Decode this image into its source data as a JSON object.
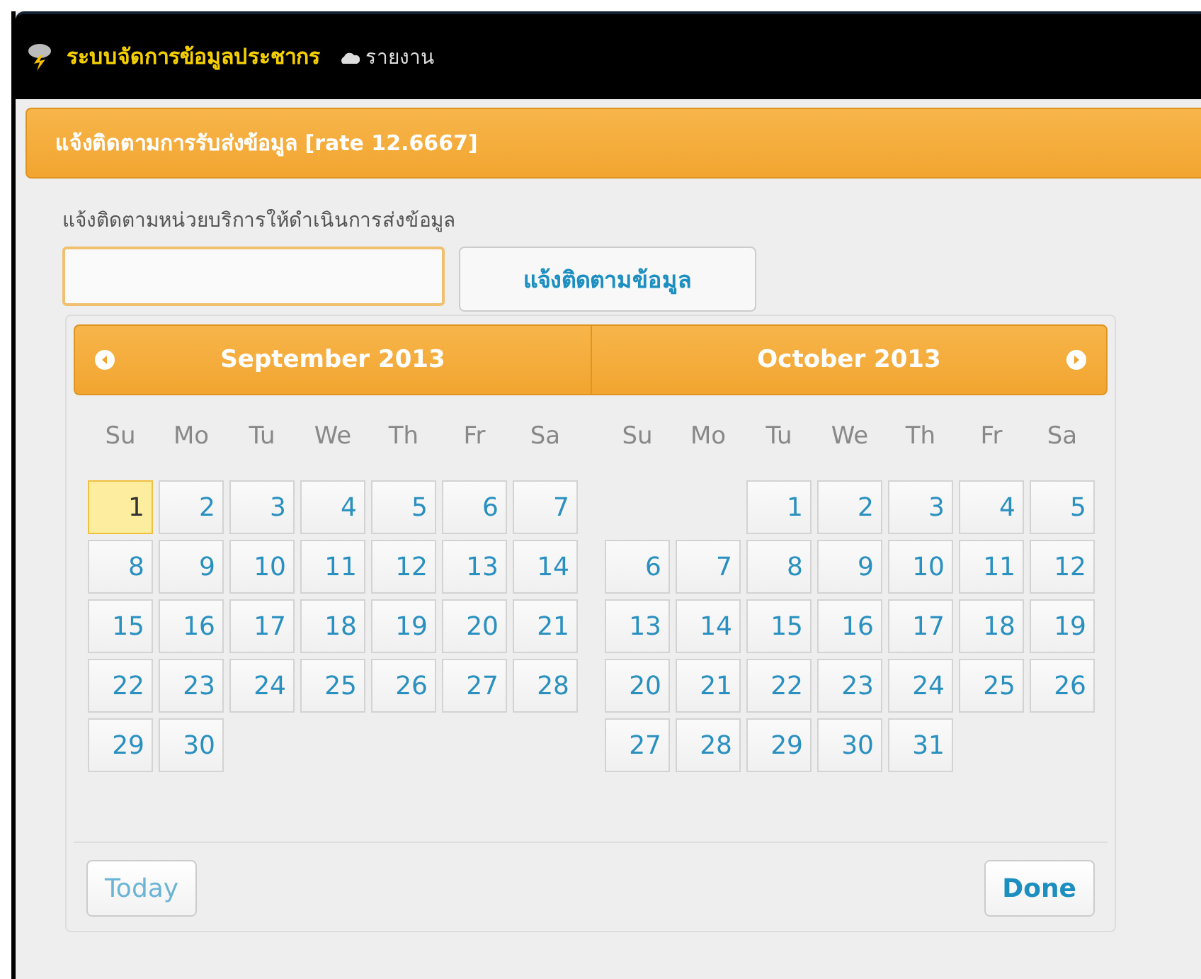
{
  "navbar": {
    "brand": "ระบบจัดการข้อมูลประชากร",
    "link": "รายงาน"
  },
  "panel": {
    "title": "แจ้งติดตามการรับส่งข้อมูล [rate 12.6667]"
  },
  "form": {
    "label": "แจ้งติดตามหน่วยบริการให้ดำเนินการส่งข้อมูล",
    "button": "แจ้งติดตามข้อมูล"
  },
  "datepicker": {
    "months": [
      {
        "title": "September 2013",
        "weekdays": [
          "Su",
          "Mo",
          "Tu",
          "We",
          "Th",
          "Fr",
          "Sa"
        ],
        "weeks": [
          [
            {
              "kind": "day",
              "d": "1",
              "today": true
            },
            {
              "kind": "day",
              "d": "2",
              "today": false
            },
            {
              "kind": "day",
              "d": "3",
              "today": false
            },
            {
              "kind": "day",
              "d": "4",
              "today": false
            },
            {
              "kind": "day",
              "d": "5",
              "today": false
            },
            {
              "kind": "day",
              "d": "6",
              "today": false
            },
            {
              "kind": "day",
              "d": "7",
              "today": false
            }
          ],
          [
            {
              "kind": "day",
              "d": "8",
              "today": false
            },
            {
              "kind": "day",
              "d": "9",
              "today": false
            },
            {
              "kind": "day",
              "d": "10",
              "today": false
            },
            {
              "kind": "day",
              "d": "11",
              "today": false
            },
            {
              "kind": "day",
              "d": "12",
              "today": false
            },
            {
              "kind": "day",
              "d": "13",
              "today": false
            },
            {
              "kind": "day",
              "d": "14",
              "today": false
            }
          ],
          [
            {
              "kind": "day",
              "d": "15",
              "today": false
            },
            {
              "kind": "day",
              "d": "16",
              "today": false
            },
            {
              "kind": "day",
              "d": "17",
              "today": false
            },
            {
              "kind": "day",
              "d": "18",
              "today": false
            },
            {
              "kind": "day",
              "d": "19",
              "today": false
            },
            {
              "kind": "day",
              "d": "20",
              "today": false
            },
            {
              "kind": "day",
              "d": "21",
              "today": false
            }
          ],
          [
            {
              "kind": "day",
              "d": "22",
              "today": false
            },
            {
              "kind": "day",
              "d": "23",
              "today": false
            },
            {
              "kind": "day",
              "d": "24",
              "today": false
            },
            {
              "kind": "day",
              "d": "25",
              "today": false
            },
            {
              "kind": "day",
              "d": "26",
              "today": false
            },
            {
              "kind": "day",
              "d": "27",
              "today": false
            },
            {
              "kind": "day",
              "d": "28",
              "today": false
            }
          ],
          [
            {
              "kind": "day",
              "d": "29",
              "today": false
            },
            {
              "kind": "day",
              "d": "30",
              "today": false
            },
            {
              "kind": "blank"
            },
            {
              "kind": "blank"
            },
            {
              "kind": "blank"
            },
            {
              "kind": "blank"
            },
            {
              "kind": "blank"
            }
          ]
        ]
      },
      {
        "title": "October 2013",
        "weekdays": [
          "Su",
          "Mo",
          "Tu",
          "We",
          "Th",
          "Fr",
          "Sa"
        ],
        "weeks": [
          [
            {
              "kind": "blank"
            },
            {
              "kind": "blank"
            },
            {
              "kind": "day",
              "d": "1",
              "today": false
            },
            {
              "kind": "day",
              "d": "2",
              "today": false
            },
            {
              "kind": "day",
              "d": "3",
              "today": false
            },
            {
              "kind": "day",
              "d": "4",
              "today": false
            },
            {
              "kind": "day",
              "d": "5",
              "today": false
            }
          ],
          [
            {
              "kind": "day",
              "d": "6",
              "today": false
            },
            {
              "kind": "day",
              "d": "7",
              "today": false
            },
            {
              "kind": "day",
              "d": "8",
              "today": false
            },
            {
              "kind": "day",
              "d": "9",
              "today": false
            },
            {
              "kind": "day",
              "d": "10",
              "today": false
            },
            {
              "kind": "day",
              "d": "11",
              "today": false
            },
            {
              "kind": "day",
              "d": "12",
              "today": false
            }
          ],
          [
            {
              "kind": "day",
              "d": "13",
              "today": false
            },
            {
              "kind": "day",
              "d": "14",
              "today": false
            },
            {
              "kind": "day",
              "d": "15",
              "today": false
            },
            {
              "kind": "day",
              "d": "16",
              "today": false
            },
            {
              "kind": "day",
              "d": "17",
              "today": false
            },
            {
              "kind": "day",
              "d": "18",
              "today": false
            },
            {
              "kind": "day",
              "d": "19",
              "today": false
            }
          ],
          [
            {
              "kind": "day",
              "d": "20",
              "today": false
            },
            {
              "kind": "day",
              "d": "21",
              "today": false
            },
            {
              "kind": "day",
              "d": "22",
              "today": false
            },
            {
              "kind": "day",
              "d": "23",
              "today": false
            },
            {
              "kind": "day",
              "d": "24",
              "today": false
            },
            {
              "kind": "day",
              "d": "25",
              "today": false
            },
            {
              "kind": "day",
              "d": "26",
              "today": false
            }
          ],
          [
            {
              "kind": "day",
              "d": "27",
              "today": false
            },
            {
              "kind": "day",
              "d": "28",
              "today": false
            },
            {
              "kind": "day",
              "d": "29",
              "today": false
            },
            {
              "kind": "day",
              "d": "30",
              "today": false
            },
            {
              "kind": "day",
              "d": "31",
              "today": false
            },
            {
              "kind": "blank"
            },
            {
              "kind": "blank"
            }
          ]
        ]
      }
    ],
    "today_button": "Today",
    "done_button": "Done"
  }
}
